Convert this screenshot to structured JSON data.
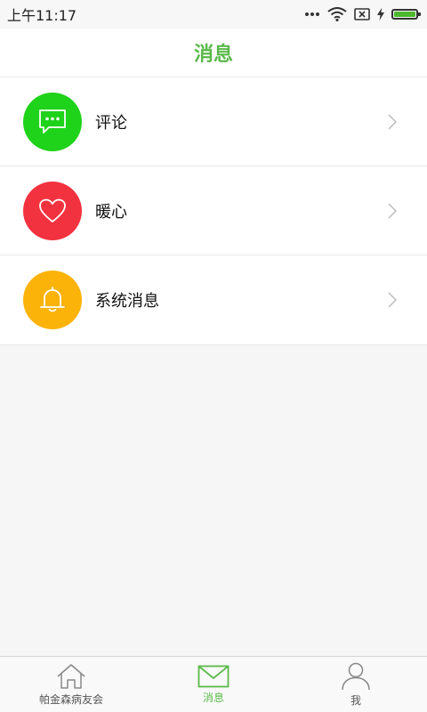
{
  "status_bar": {
    "time": "上午11:17"
  },
  "header": {
    "title": "消息"
  },
  "items": [
    {
      "label": "评论",
      "icon": "comment-icon",
      "color": "#1fd21a"
    },
    {
      "label": "暖心",
      "icon": "heart-icon",
      "color": "#f3323f"
    },
    {
      "label": "系统消息",
      "icon": "bell-icon",
      "color": "#fbb30a"
    }
  ],
  "tabs": [
    {
      "label": "帕金森病友会",
      "icon": "home-icon",
      "active": false
    },
    {
      "label": "消息",
      "icon": "mail-icon",
      "active": true
    },
    {
      "label": "我",
      "icon": "user-icon",
      "active": false
    }
  ],
  "colors": {
    "accent": "#5ab94a",
    "background": "#f6f6f6"
  }
}
